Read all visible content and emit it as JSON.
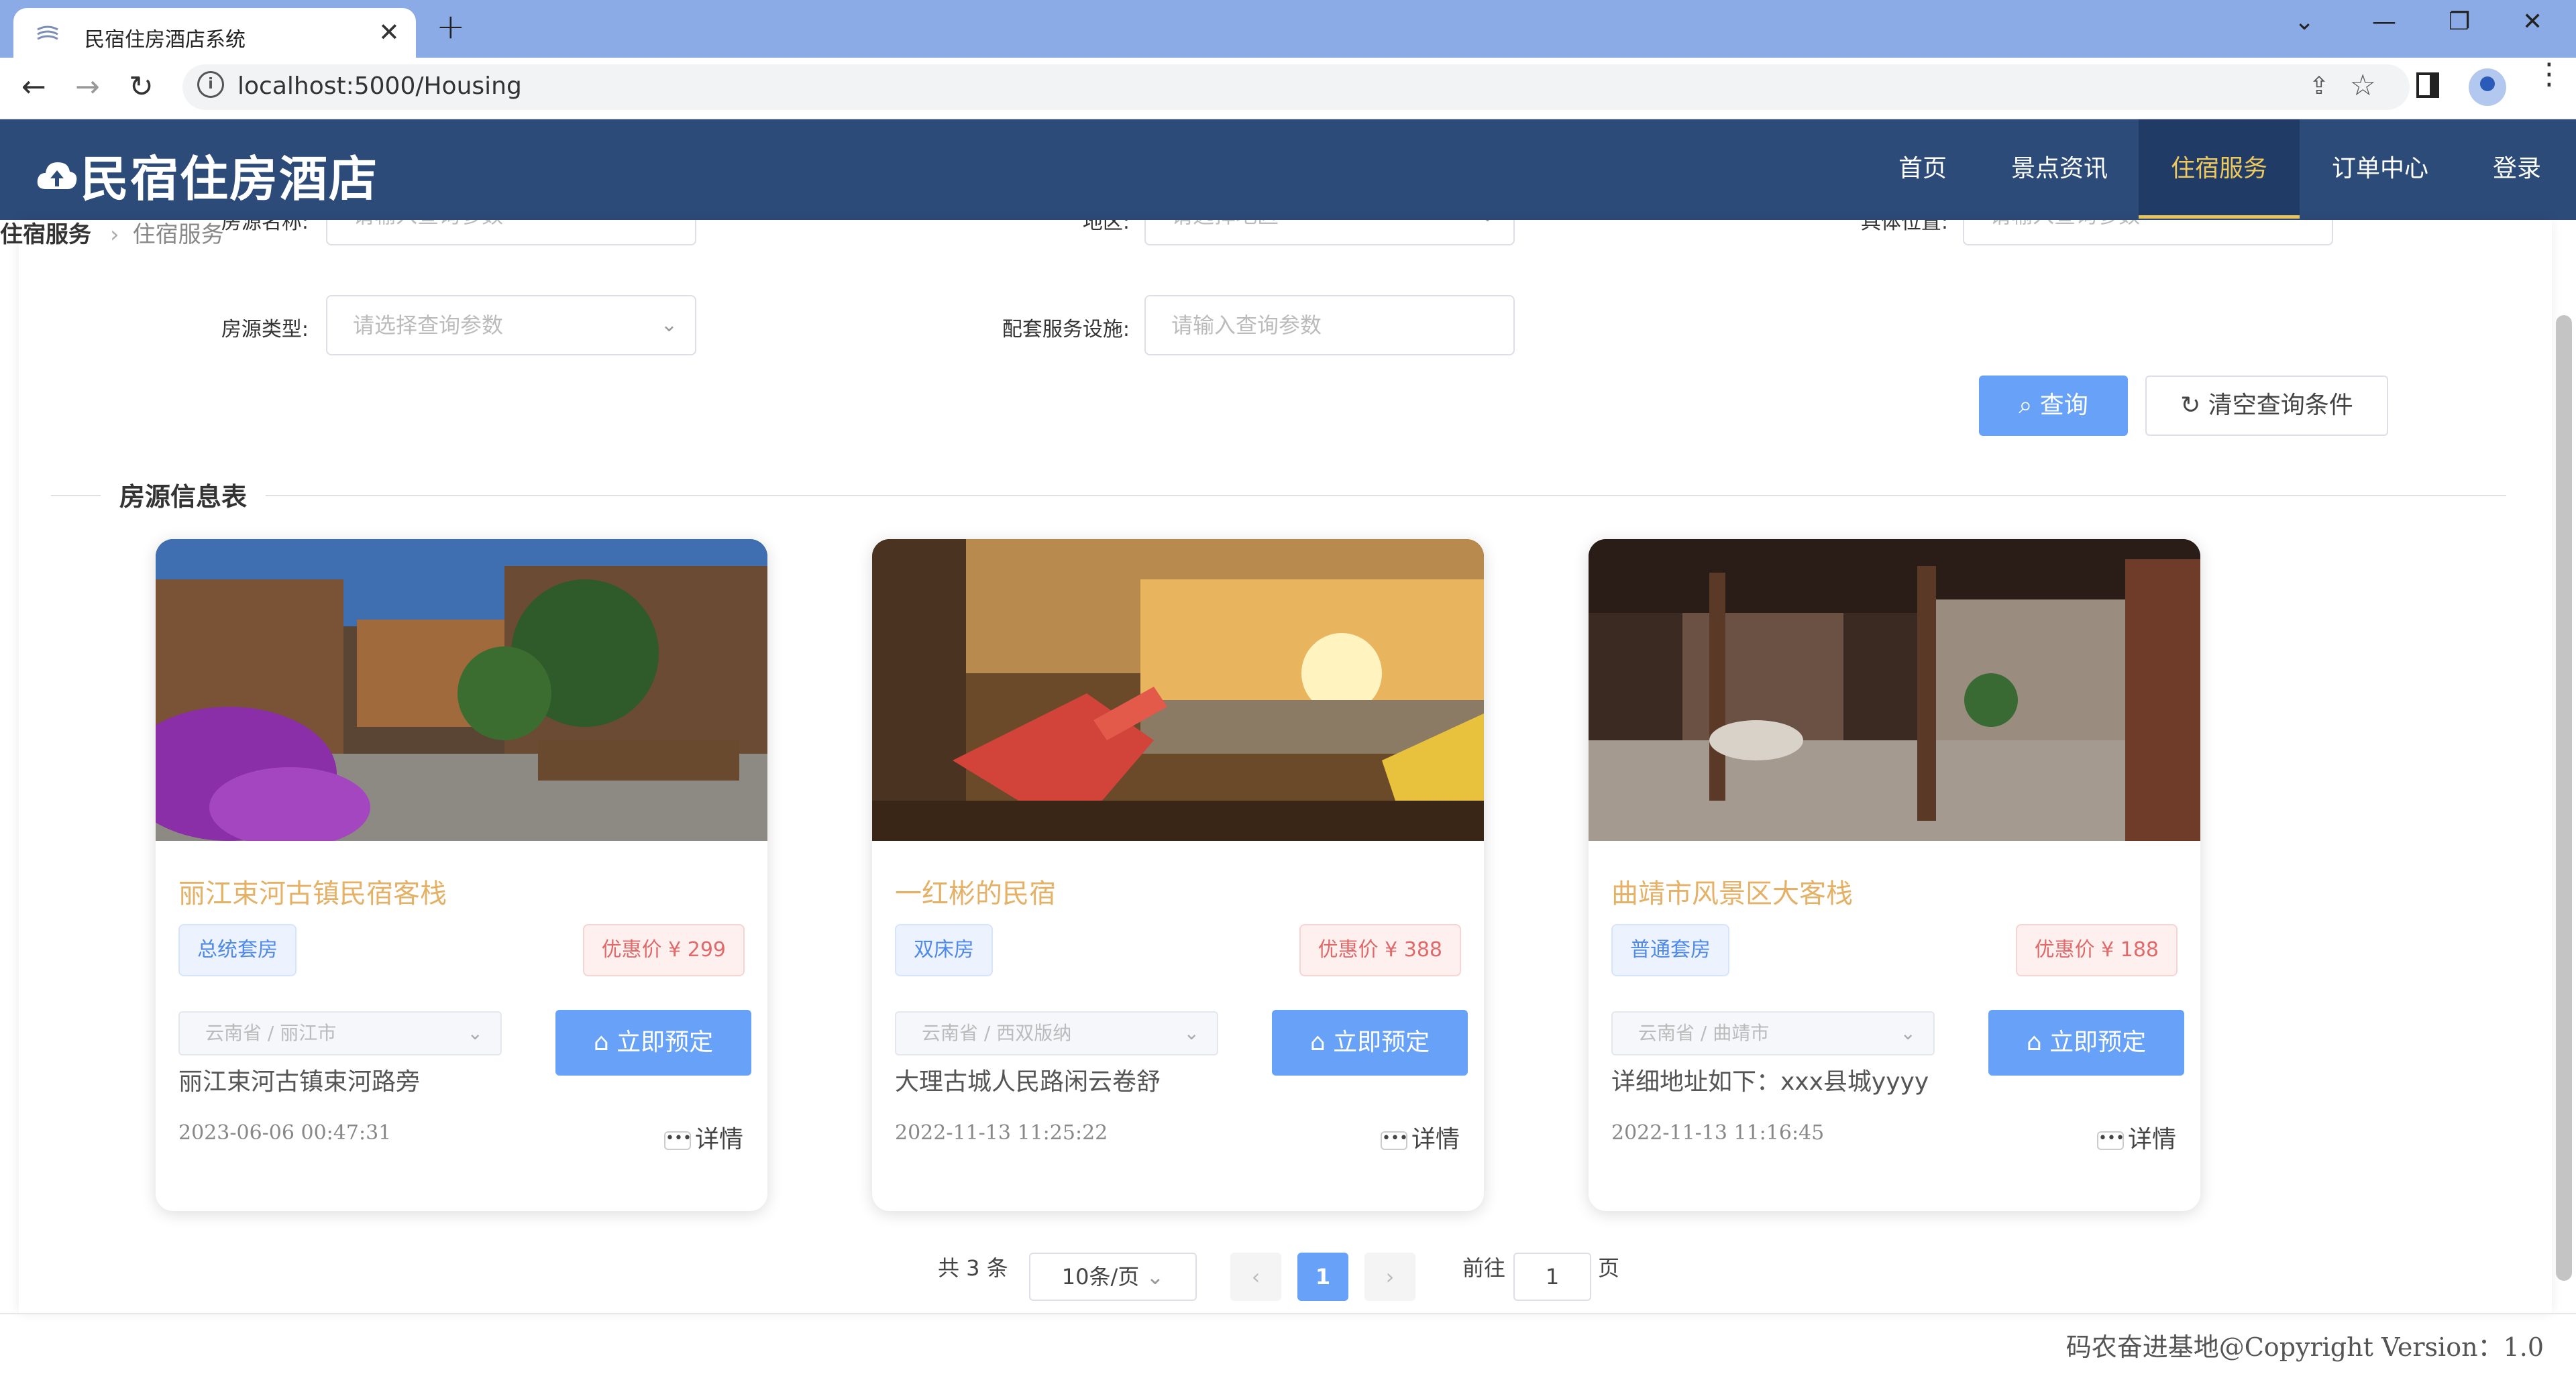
{
  "browser": {
    "tab_title": "民宿住房酒店系统",
    "url": "localhost:5000/Housing"
  },
  "site": {
    "logo_text": "民宿住房酒店",
    "nav": [
      "首页",
      "景点资讯",
      "住宿服务",
      "订单中心",
      "登录"
    ],
    "active_nav": "住宿服务"
  },
  "breadcrumb": {
    "parent": "住宿服务",
    "current": "住宿服务"
  },
  "search": {
    "name_label": "房源名称:",
    "name_placeholder": "请输入查询参数",
    "region_label": "地区:",
    "region_placeholder": "请选择地区",
    "location_label": "具体位置:",
    "location_placeholder": "请输入查询参数",
    "type_label": "房源类型:",
    "type_placeholder": "请选择查询参数",
    "facility_label": "配套服务设施:",
    "facility_placeholder": "请输入查询参数",
    "query_button": "查询",
    "clear_button": "清空查询条件"
  },
  "section_title": "房源信息表",
  "listings": [
    {
      "name": "丽江束河古镇民宿客栈",
      "type": "总统套房",
      "price": "优惠价 ¥ 299",
      "region": "云南省 / 丽江市",
      "address": "丽江束河古镇束河路旁",
      "time": "2023-06-06 00:47:31",
      "book": "立即预定",
      "detail": "详情"
    },
    {
      "name": "一红彬的民宿",
      "type": "双床房",
      "price": "优惠价 ¥ 388",
      "region": "云南省 / 西双版纳",
      "address": "大理古城人民路闲云卷舒",
      "time": "2022-11-13 11:25:22",
      "book": "立即预定",
      "detail": "详情"
    },
    {
      "name": "曲靖市风景区大客栈",
      "type": "普通套房",
      "price": "优惠价 ¥ 188",
      "region": "云南省 / 曲靖市",
      "address": "详细地址如下：xxx县城yyyy",
      "time": "2022-11-13 11:16:45",
      "book": "立即预定",
      "detail": "详情"
    }
  ],
  "pagination": {
    "total": "共 3 条",
    "page_size": "10条/页",
    "current_page": "1",
    "goto_label": "前往",
    "goto_value": "1",
    "page_suffix": "页"
  },
  "footer": "码农奋进基地@Copyright Version：1.0",
  "colors": {
    "header": "#2d4b79",
    "accent": "#67a1f8",
    "active_nav": "#f0c95c",
    "title": "#e4b166"
  }
}
